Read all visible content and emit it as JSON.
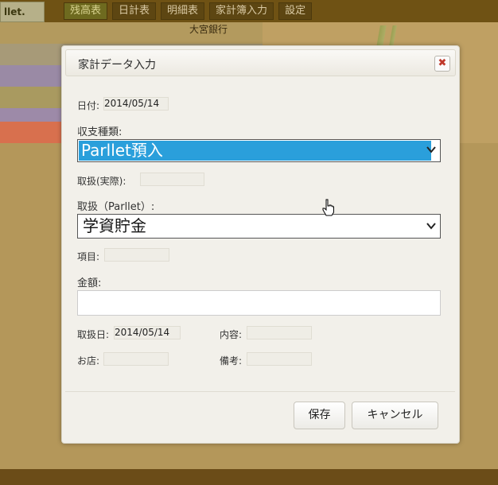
{
  "background": {
    "logo_text": "llet.",
    "nav_tabs": [
      "残高表",
      "日計表",
      "明細表",
      "家計簿入力",
      "設定"
    ],
    "bank_text": "大宮銀行",
    "stripe_colors": [
      "#b39a5e",
      "#a79a78",
      "#9a8aa5",
      "#a99a60",
      "#9d8aa8",
      "#d8704e"
    ]
  },
  "dialog": {
    "title": "家計データ入力",
    "close_label": "✖",
    "date_label": "日付:",
    "date_value": "2014/05/14",
    "type_label": "収支種類:",
    "type_value": "Parllet預入",
    "actual_label": "取扱(実際):",
    "actual_value": "",
    "parllet_label": "取扱（Parllet）:",
    "parllet_value": "学資貯金",
    "item_label": "項目:",
    "item_value": "",
    "amount_label": "金額:",
    "amount_value": "",
    "handling_date_label": "取扱日:",
    "handling_date_value": "2014/05/14",
    "content_label": "内容:",
    "content_value": "",
    "shop_label": "お店:",
    "shop_value": "",
    "note_label": "備考:",
    "note_value": "",
    "save_label": "保存",
    "cancel_label": "キャンセル"
  },
  "colors": {
    "select_highlight": "#2a9fdb",
    "close_icon": "#c0392b"
  }
}
